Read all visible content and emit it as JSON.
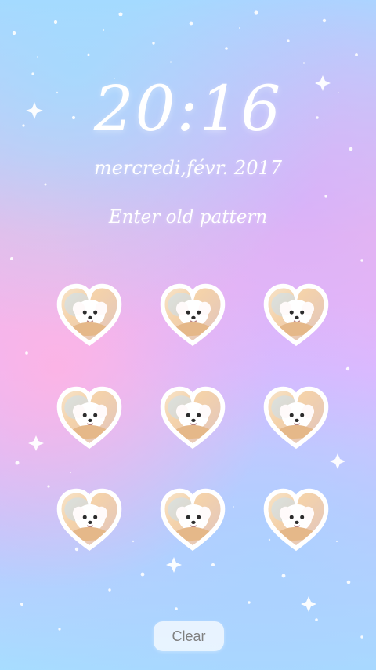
{
  "lockscreen": {
    "time": "20:16",
    "date": "mercredi,févr. 2017",
    "prompt": "Enter old pattern",
    "clear_label": "Clear"
  },
  "pattern": {
    "dots": [
      "heart-puppy-icon",
      "heart-puppy-icon",
      "heart-puppy-icon",
      "heart-puppy-icon",
      "heart-puppy-icon",
      "heart-puppy-icon",
      "heart-puppy-icon",
      "heart-puppy-icon",
      "heart-puppy-icon"
    ]
  },
  "theme": {
    "text_color": "#ffffff",
    "button_text_color": "#808080",
    "accent_pink": "#f0b8e8",
    "accent_blue": "#a8d8ff",
    "accent_purple": "#e6b7ff"
  }
}
